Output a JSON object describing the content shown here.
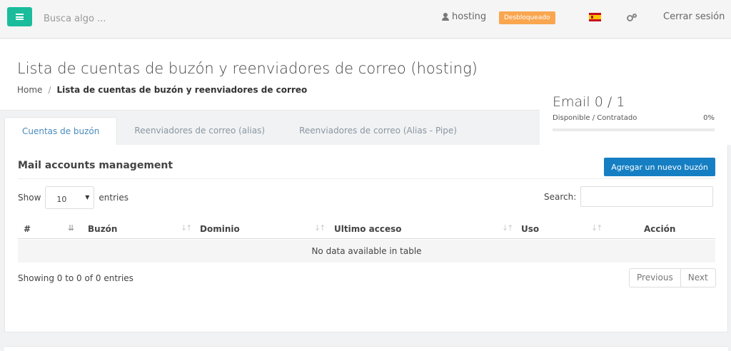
{
  "topbar": {
    "search_placeholder": "Busca algo ...",
    "user": "hosting",
    "badge": "Desbloqueado",
    "logout": "Cerrar sesión"
  },
  "header": {
    "title": "Lista de cuentas de buzón y reenviadores de correo (hosting)",
    "breadcrumb_home": "Home",
    "breadcrumb_sep": "/",
    "breadcrumb_current": "Lista de cuentas de buzón y reenviadores de correo"
  },
  "stats": {
    "title": "Email 0 / 1",
    "subtitle": "Disponible / Contratado",
    "percent_label": "0%",
    "percent": 0
  },
  "tabs": [
    {
      "label": "Cuentas de buzón"
    },
    {
      "label": "Reenviadores de correo (alias)"
    },
    {
      "label": "Reenviadores de correo (Alias - Pipe)"
    }
  ],
  "panel": {
    "title": "Mail accounts management",
    "add_button": "Agregar un nuevo buzón",
    "show_label": "Show",
    "entries_label": "entries",
    "page_size": "10",
    "search_label": "Search:"
  },
  "table": {
    "columns": [
      "#",
      "Buzón",
      "Dominio",
      "Ultimo acceso",
      "Uso",
      "Acción"
    ],
    "empty_message": "No data available in table",
    "info": "Showing 0 to 0 of 0 entries",
    "previous": "Previous",
    "next": "Next"
  }
}
